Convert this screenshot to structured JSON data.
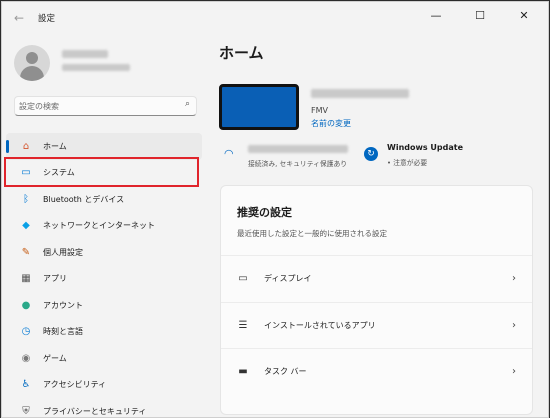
{
  "window": {
    "title": "設定",
    "back_icon": "←",
    "minimize_icon": "—",
    "maximize_icon": "☐",
    "close_icon": "✕"
  },
  "sidebar": {
    "search_placeholder": "設定の検索",
    "search_icon": "⌕",
    "items": [
      {
        "label": "ホーム",
        "icon": "home-icon",
        "glyph": "⌂",
        "color": "#d5562f"
      },
      {
        "label": "システム",
        "icon": "system-icon",
        "glyph": "▭",
        "color": "#0078d4"
      },
      {
        "label": "Bluetooth とデバイス",
        "icon": "bluetooth-icon",
        "glyph": "ᛒ",
        "color": "#0078d4"
      },
      {
        "label": "ネットワークとインターネット",
        "icon": "network-icon",
        "glyph": "◆",
        "color": "#0aa0e6"
      },
      {
        "label": "個人用設定",
        "icon": "brush-icon",
        "glyph": "✎",
        "color": "#c55a11"
      },
      {
        "label": "アプリ",
        "icon": "apps-icon",
        "glyph": "▦",
        "color": "#555555"
      },
      {
        "label": "アカウント",
        "icon": "account-icon",
        "glyph": "●",
        "color": "#2aa889"
      },
      {
        "label": "時刻と言語",
        "icon": "clock-language-icon",
        "glyph": "◷",
        "color": "#0078d4"
      },
      {
        "label": "ゲーム",
        "icon": "game-icon",
        "glyph": "◉",
        "color": "#777777"
      },
      {
        "label": "アクセシビリティ",
        "icon": "accessibility-icon",
        "glyph": "♿",
        "color": "#0a6fc2"
      },
      {
        "label": "プライバシーとセキュリティ",
        "icon": "shield-icon",
        "glyph": "⛨",
        "color": "#555555"
      }
    ]
  },
  "main": {
    "title": "ホーム",
    "device_model": "FMV",
    "rename_link": "名前の変更",
    "wifi_status": "接続済み, セキュリティ保護あり",
    "windows_update_title": "Windows Update",
    "windows_update_status": "• 注意が必要",
    "recommended": {
      "title": "推奨の設定",
      "subtitle": "最近使用した設定と一般的に使用される設定",
      "rows": [
        {
          "label": "ディスプレイ",
          "icon": "display-icon",
          "glyph": "▭"
        },
        {
          "label": "インストールされているアプリ",
          "icon": "app-list-icon",
          "glyph": "☰"
        },
        {
          "label": "タスク バー",
          "icon": "taskbar-icon",
          "glyph": "▬"
        }
      ],
      "chevron": "›"
    }
  },
  "colors": {
    "accent": "#0067c0",
    "highlight_border": "#e0242b",
    "device_screen": "#0a5fb5"
  }
}
